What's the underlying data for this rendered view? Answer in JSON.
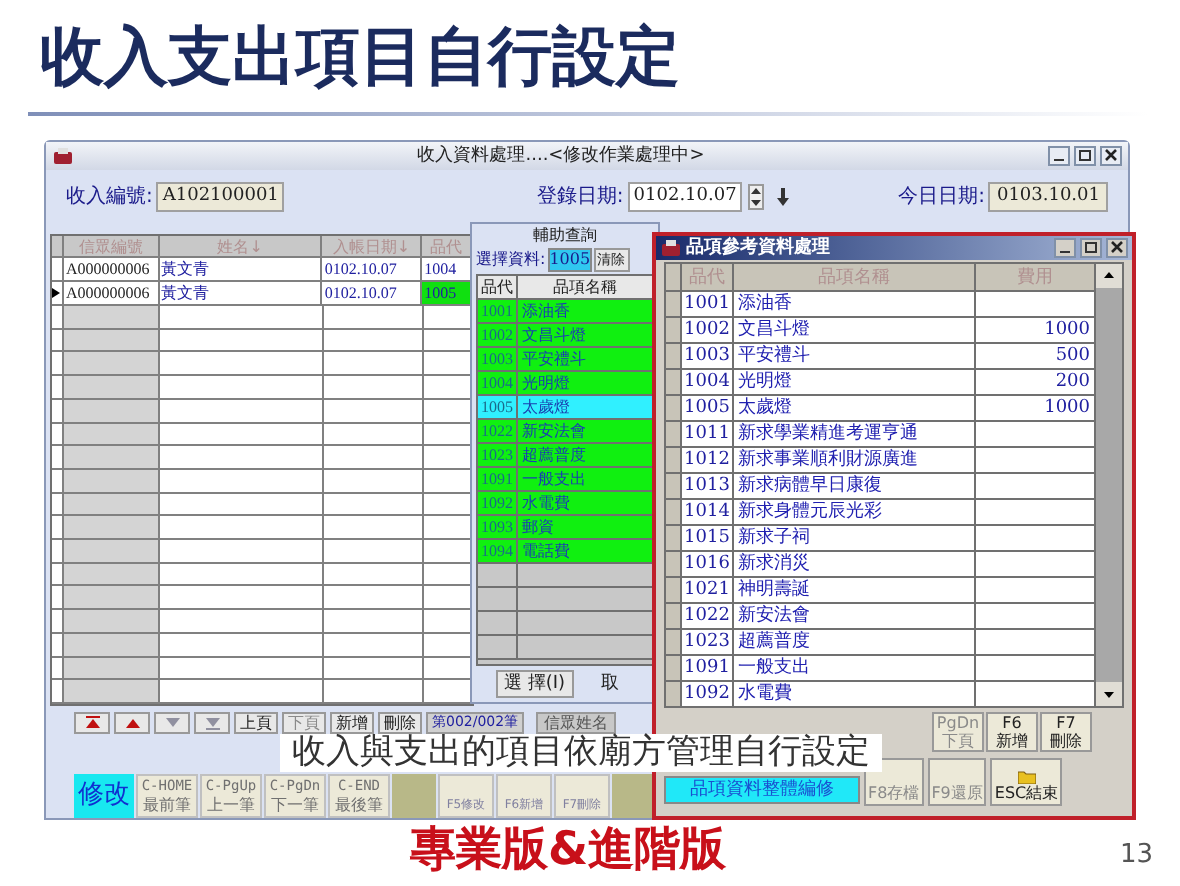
{
  "slide": {
    "title": "收入支出項目自行設定",
    "caption": "收入與支出的項目依廟方管理自行設定",
    "subtitle": "專業版&進階版",
    "page_number": "13"
  },
  "main_window": {
    "title": "收入資料處理....<修改作業處理中>",
    "fields": [
      {
        "label": "收入編號:",
        "value": "A102100001"
      },
      {
        "label": "登錄日期:",
        "value": "0102.10.07"
      },
      {
        "label": "今日日期:",
        "value": "0103.10.01"
      }
    ],
    "table": {
      "columns": [
        "信眾編號",
        "姓名↓",
        "入帳日期↓",
        "品代"
      ],
      "rows": [
        {
          "cells": [
            "A000000006",
            "黃文青",
            "0102.10.07",
            "1004"
          ],
          "selected": false
        },
        {
          "cells": [
            "A000000006",
            "黃文青",
            "0102.10.07",
            "1005"
          ],
          "selected": true
        }
      ]
    },
    "nav_buttons": [
      {
        "label": "上頁",
        "disabled": false
      },
      {
        "label": "下頁",
        "disabled": true
      },
      {
        "label": "新增",
        "disabled": false
      },
      {
        "label": "刪除",
        "disabled": false
      }
    ],
    "record_counter": "第002/002筆",
    "name_header": "信眾姓名",
    "mode": "修改",
    "function_buttons": [
      {
        "key": "C-HOME",
        "label": "最前筆"
      },
      {
        "key": "C-PgUp",
        "label": "上一筆"
      },
      {
        "key": "C-PgDn",
        "label": "下一筆"
      },
      {
        "key": "C-END",
        "label": "最後筆"
      }
    ],
    "action_buttons": [
      "F5修改",
      "F6新增",
      "F7刪除"
    ]
  },
  "lookup_dialog": {
    "title": "輔助查詢",
    "search_label": "選擇資料:",
    "search_value": "1005",
    "clear_button": "清除",
    "columns": [
      "品代",
      "品項名稱"
    ],
    "rows": [
      {
        "code": "1001",
        "name": "添油香",
        "selected": false
      },
      {
        "code": "1002",
        "name": "文昌斗燈",
        "selected": false
      },
      {
        "code": "1003",
        "name": "平安禮斗",
        "selected": false
      },
      {
        "code": "1004",
        "name": "光明燈",
        "selected": false
      },
      {
        "code": "1005",
        "name": "太歲燈",
        "selected": true
      },
      {
        "code": "1022",
        "name": "新安法會",
        "selected": false
      },
      {
        "code": "1023",
        "name": "超薦普度",
        "selected": false
      },
      {
        "code": "1091",
        "name": "一般支出",
        "selected": false
      },
      {
        "code": "1092",
        "name": "水電費",
        "selected": false
      },
      {
        "code": "1093",
        "name": "郵資",
        "selected": false
      },
      {
        "code": "1094",
        "name": "電話費",
        "selected": false
      }
    ],
    "select_button": "選 擇(I)",
    "cancel_button": "取"
  },
  "items_window": {
    "title": "品項參考資料處理",
    "columns": [
      "品代",
      "品項名稱",
      "費用"
    ],
    "rows": [
      {
        "code": "1001",
        "name": "添油香"
      },
      {
        "code": "1002",
        "name": "文昌斗燈",
        "fee": "1000"
      },
      {
        "code": "1003",
        "name": "平安禮斗",
        "fee": "500"
      },
      {
        "code": "1004",
        "name": "光明燈",
        "fee": "200"
      },
      {
        "code": "1005",
        "name": "太歲燈",
        "fee": "1000"
      },
      {
        "code": "1011",
        "name": "新求學業精進考運亨通"
      },
      {
        "code": "1012",
        "name": "新求事業順利財源廣進"
      },
      {
        "code": "1013",
        "name": "新求病體早日康復"
      },
      {
        "code": "1014",
        "name": "新求身體元辰光彩"
      },
      {
        "code": "1015",
        "name": "新求子祠"
      },
      {
        "code": "1016",
        "name": "新求消災"
      },
      {
        "code": "1021",
        "name": "神明壽誕"
      },
      {
        "code": "1022",
        "name": "新安法會"
      },
      {
        "code": "1023",
        "name": "超薦普度"
      },
      {
        "code": "1091",
        "name": "一般支出"
      },
      {
        "code": "1092",
        "name": "水電費"
      }
    ],
    "top_buttons": [
      {
        "key": "PgDn",
        "label": "下頁",
        "disabled": true
      },
      {
        "key": "F6",
        "label": "新增",
        "disabled": false
      },
      {
        "key": "F7",
        "label": "刪除",
        "disabled": false
      }
    ],
    "edit_button": "品項資料整體編修",
    "bottom_buttons": [
      {
        "label": "F8存檔",
        "disabled": true
      },
      {
        "label": "F9還原",
        "disabled": true
      },
      {
        "label": "ESC結束",
        "disabled": false
      }
    ]
  }
}
